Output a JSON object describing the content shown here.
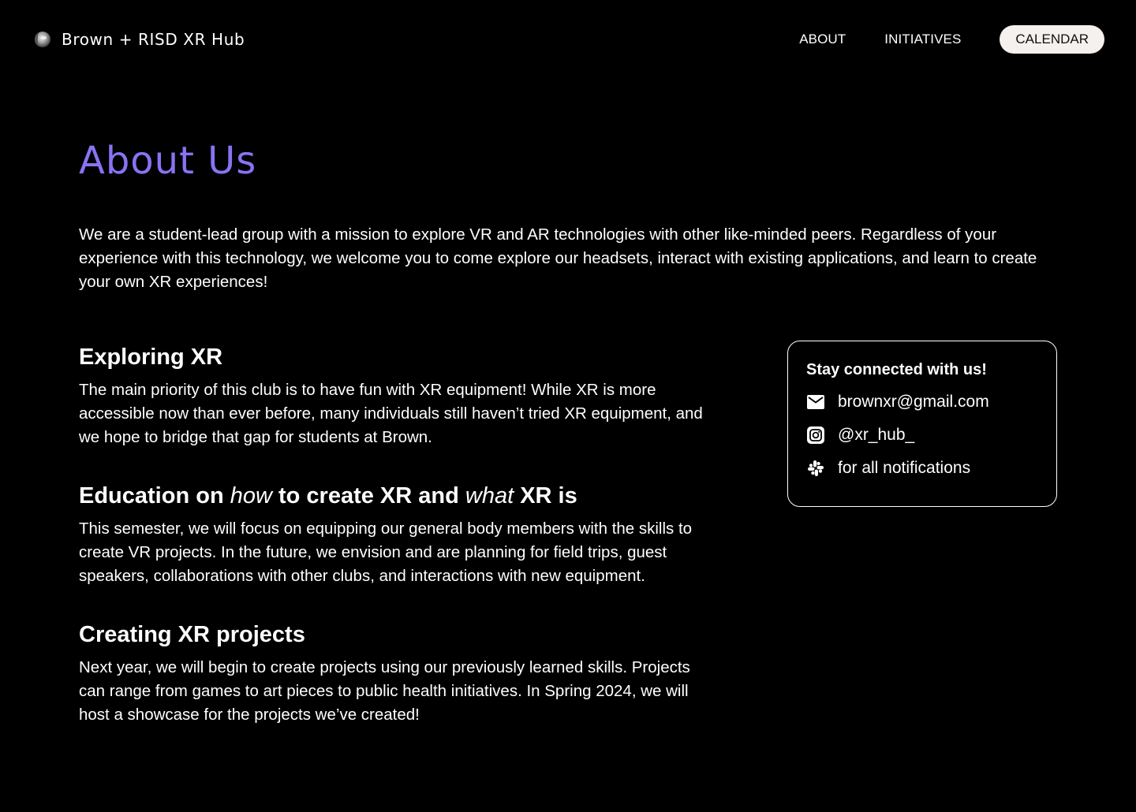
{
  "header": {
    "brand": "Brown + RISD XR Hub",
    "nav": {
      "about": "ABOUT",
      "initiatives": "INITIATIVES",
      "calendar": "CALENDAR"
    }
  },
  "hero": {
    "title": "About Us",
    "intro": "We are a student-lead group with a mission to explore VR and AR technologies with other like-minded peers. Regardless of your experience with this technology, we welcome you to come explore our headsets, interact with existing applications, and learn to create your own XR experiences!"
  },
  "sections": [
    {
      "heading": "Exploring XR",
      "body": "The main priority of this club is to have fun with XR equipment! While XR is more accessible now than ever before, many individuals still haven’t tried XR equipment, and we hope to bridge that gap for students at Brown."
    },
    {
      "heading_parts": [
        "Education on ",
        "how",
        " to create XR and ",
        "what",
        " XR is"
      ],
      "body": "This semester, we will focus on equipping our general body members with the skills to create VR projects. In the future, we envision and are planning for field trips, guest speakers, collaborations with other clubs, and interactions with new equipment."
    },
    {
      "heading": "Creating XR projects",
      "body": "Next year, we will begin to create projects using our previously learned skills. Projects can range from games to art pieces to public health initiatives. In Spring 2024, we will host a showcase for the projects we’ve created!"
    }
  ],
  "contact": {
    "title": "Stay connected with us!",
    "email": {
      "icon": "mail-icon",
      "text": "brownxr@gmail.com"
    },
    "instagram": {
      "icon": "instagram-icon",
      "text": "@xr_hub_"
    },
    "slack": {
      "icon": "slack-icon",
      "text": "for all notifications"
    }
  },
  "colors": {
    "background": "#000000",
    "text": "#ffffff",
    "accent": "#8a72f4",
    "cta_background": "#f4f1ee"
  }
}
